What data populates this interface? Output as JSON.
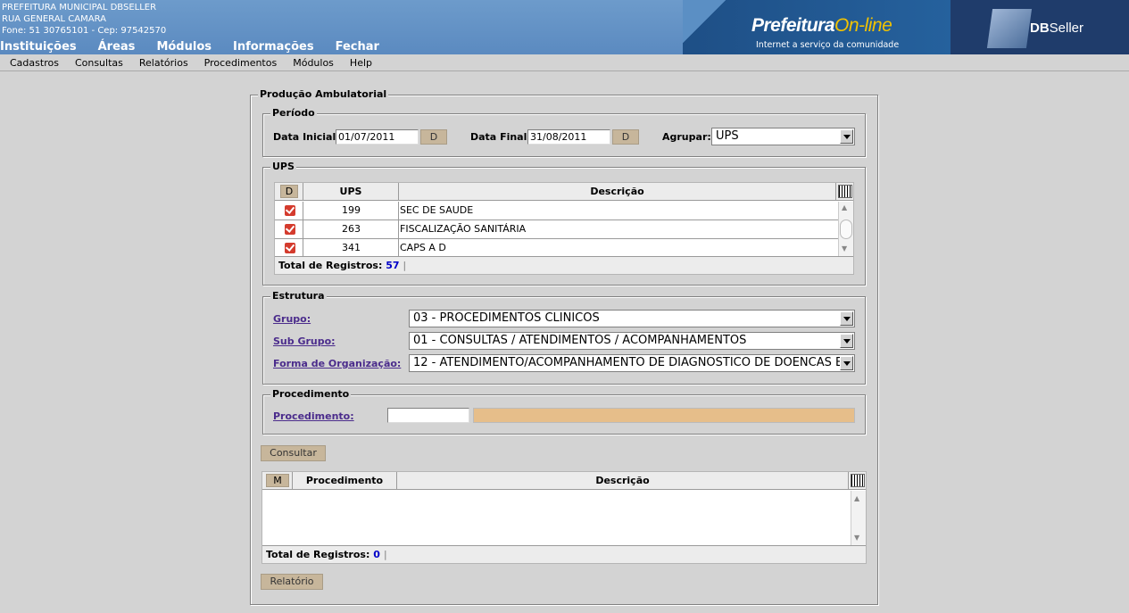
{
  "header": {
    "org_name": "PREFEITURA MUNICIPAL DBSELLER",
    "address": "RUA GENERAL CAMARA",
    "contact": "Fone: 51 30765101  -  Cep: 97542570",
    "nav": [
      "Instituições",
      "Áreas",
      "Módulos",
      "Informações",
      "Fechar"
    ],
    "brand_main": "Prefeitura",
    "brand_online": "On-line",
    "brand_tagline": "Internet a serviço da comunidade",
    "company_bold": "DB",
    "company_rest": "Seller"
  },
  "menu": [
    "Cadastros",
    "Consultas",
    "Relatórios",
    "Procedimentos",
    "Módulos",
    "Help"
  ],
  "form": {
    "title": "Produção Ambulatorial",
    "periodo": {
      "legend": "Período",
      "data_inicial_label": "Data Inicial:",
      "data_inicial": "01/07/2011",
      "data_final_label": "Data Final:",
      "data_final": "31/08/2011",
      "date_button": "D",
      "agrupar_label": "Agrupar:",
      "agrupar_value": "UPS"
    },
    "ups": {
      "legend": "UPS",
      "col_d": "D",
      "col_ups": "UPS",
      "col_desc": "Descrição",
      "rows": [
        {
          "ups": "199",
          "desc": "SEC DE SAUDE"
        },
        {
          "ups": "263",
          "desc": "FISCALIZAÇÃO SANITÁRIA"
        },
        {
          "ups": "341",
          "desc": "CAPS A D"
        }
      ],
      "total_label": "Total de Registros:",
      "total": "57"
    },
    "estrutura": {
      "legend": "Estrutura",
      "grupo_label": "Grupo:",
      "grupo_value": "03 - PROCEDIMENTOS CLINICOS",
      "subgrupo_label": "Sub Grupo:",
      "subgrupo_value": "01 - CONSULTAS / ATENDIMENTOS / ACOMPANHAMENTOS",
      "forma_label": "Forma de Organização:",
      "forma_value": "12 - ATENDIMENTO/ACOMPANHAMENTO DE DIAGNOSTICO DE DOENCAS E"
    },
    "procedimento": {
      "legend": "Procedimento",
      "label": "Procedimento:"
    },
    "consultar_button": "Consultar",
    "result_grid": {
      "col_m": "M",
      "col_proc": "Procedimento",
      "col_desc": "Descrição",
      "total_label": "Total de Registros:",
      "total": "0"
    },
    "relatorio_button": "Relatório"
  }
}
